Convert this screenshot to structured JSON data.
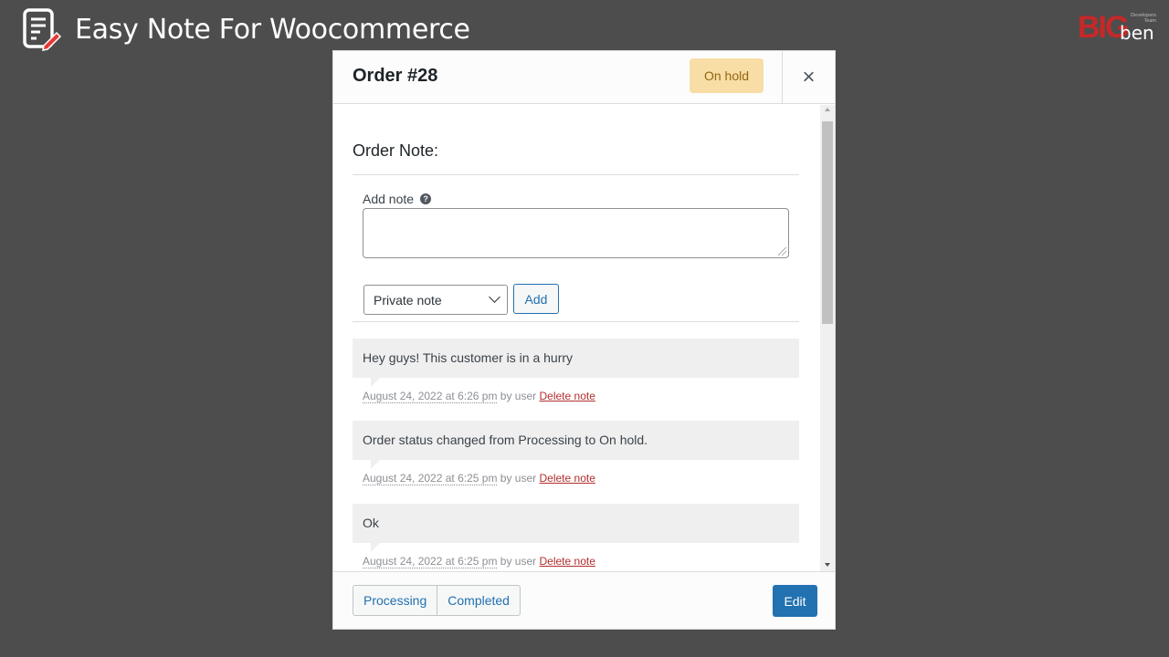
{
  "app": {
    "title": "Easy Note For Woocommerce"
  },
  "logo": {
    "big": "BIG",
    "ben": "ben",
    "subtitle": "Developers Team"
  },
  "modal": {
    "order_title": "Order #28",
    "status": "On hold",
    "close_symbol": "×",
    "section_title": "Order Note:",
    "add_note_label": "Add note",
    "help_symbol": "?",
    "note_textarea_value": "",
    "note_type_selected": "Private note",
    "add_button_label": "Add",
    "notes": [
      {
        "text": "Hey guys! This customer is in a hurry",
        "date": "August 24, 2022 at 6:26 pm",
        "by": "by user",
        "delete_label": "Delete note"
      },
      {
        "text": "Order status changed from Processing to On hold.",
        "date": "August 24, 2022 at 6:25 pm",
        "by": "by user",
        "delete_label": "Delete note"
      },
      {
        "text": "Ok",
        "date": "August 24, 2022 at 6:25 pm",
        "by": "by user",
        "delete_label": "Delete note"
      }
    ],
    "footer": {
      "status_buttons": [
        "Processing",
        "Completed"
      ],
      "edit_label": "Edit"
    }
  },
  "colors": {
    "background": "#4d4d4d",
    "badge_on_hold": "#f8dda7",
    "primary": "#2271b1",
    "delete_link": "#b32d2e",
    "logo_red": "#c62828"
  }
}
